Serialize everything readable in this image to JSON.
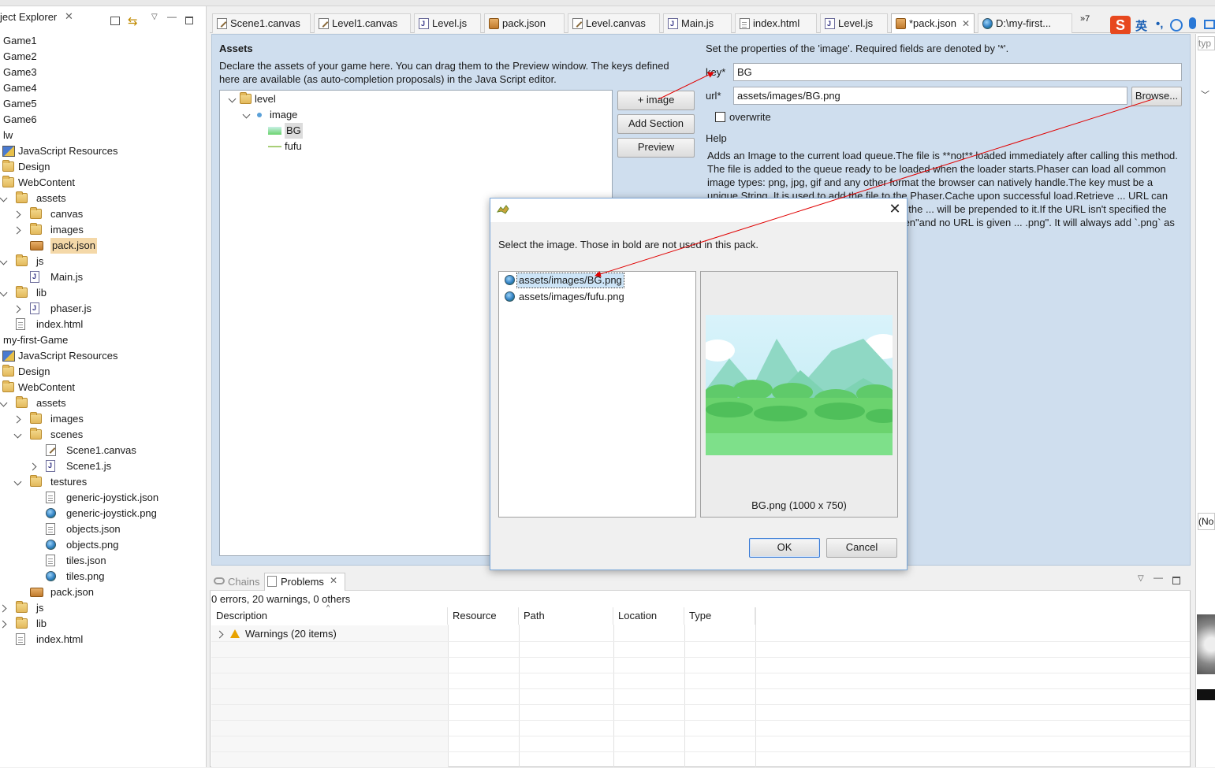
{
  "explorer": {
    "title": "ject Explorer",
    "rows": [
      {
        "label": "Game1",
        "icon": "project-icon",
        "depth": 0,
        "expander": "none"
      },
      {
        "label": "Game2",
        "icon": "project-icon",
        "depth": 0,
        "expander": "none"
      },
      {
        "label": "Game3",
        "icon": "project-icon",
        "depth": 0,
        "expander": "none"
      },
      {
        "label": "Game4",
        "icon": "project-icon",
        "depth": 0,
        "expander": "none"
      },
      {
        "label": "Game5",
        "icon": "project-icon",
        "depth": 0,
        "expander": "none"
      },
      {
        "label": "Game6",
        "icon": "project-icon",
        "depth": 0,
        "expander": "none"
      },
      {
        "label": "lw",
        "icon": "project-icon",
        "depth": 0,
        "expander": "none"
      },
      {
        "label": "JavaScript Resources",
        "icon": "js-resources-icon",
        "depth": 0,
        "expander": "none"
      },
      {
        "label": "Design",
        "icon": "folder-icon",
        "depth": 0,
        "expander": "none"
      },
      {
        "label": "WebContent",
        "icon": "folder-icon",
        "depth": 0,
        "expander": "none"
      },
      {
        "label": "assets",
        "icon": "folder-icon",
        "depth": 1,
        "expander": "open"
      },
      {
        "label": "canvas",
        "icon": "folder-icon",
        "depth": 2,
        "expander": "closed"
      },
      {
        "label": "images",
        "icon": "folder-icon",
        "depth": 2,
        "expander": "closed"
      },
      {
        "label": "pack.json",
        "icon": "pack-icon",
        "depth": 2,
        "expander": "none",
        "selected": true
      },
      {
        "label": "js",
        "icon": "folder-icon",
        "depth": 1,
        "expander": "open"
      },
      {
        "label": "Main.js",
        "icon": "js-file-icon",
        "depth": 2,
        "expander": "none"
      },
      {
        "label": "lib",
        "icon": "folder-icon",
        "depth": 1,
        "expander": "open"
      },
      {
        "label": "phaser.js",
        "icon": "js-file-icon",
        "depth": 2,
        "expander": "closed"
      },
      {
        "label": "index.html",
        "icon": "file-icon",
        "depth": 1,
        "expander": "none"
      },
      {
        "label": "my-first-Game",
        "icon": "project-icon",
        "depth": 0,
        "expander": "none"
      },
      {
        "label": "JavaScript Resources",
        "icon": "js-resources-icon",
        "depth": 0,
        "expander": "none"
      },
      {
        "label": "Design",
        "icon": "folder-icon",
        "depth": 0,
        "expander": "none"
      },
      {
        "label": "WebContent",
        "icon": "folder-icon",
        "depth": 0,
        "expander": "none"
      },
      {
        "label": "assets",
        "icon": "folder-icon",
        "depth": 1,
        "expander": "open"
      },
      {
        "label": "images",
        "icon": "folder-icon",
        "depth": 2,
        "expander": "closed"
      },
      {
        "label": "scenes",
        "icon": "folder-icon",
        "depth": 2,
        "expander": "open"
      },
      {
        "label": "Scene1.canvas",
        "icon": "canvas-file-icon",
        "depth": 3,
        "expander": "none"
      },
      {
        "label": "Scene1.js",
        "icon": "js-file-icon",
        "depth": 3,
        "expander": "closed"
      },
      {
        "label": "testures",
        "icon": "folder-icon",
        "depth": 2,
        "expander": "open"
      },
      {
        "label": "generic-joystick.json",
        "icon": "file-icon",
        "depth": 3,
        "expander": "none"
      },
      {
        "label": "generic-joystick.png",
        "icon": "image-file-icon",
        "depth": 3,
        "expander": "none"
      },
      {
        "label": "objects.json",
        "icon": "file-icon",
        "depth": 3,
        "expander": "none"
      },
      {
        "label": "objects.png",
        "icon": "image-file-icon",
        "depth": 3,
        "expander": "none"
      },
      {
        "label": "tiles.json",
        "icon": "file-icon",
        "depth": 3,
        "expander": "none"
      },
      {
        "label": "tiles.png",
        "icon": "image-file-icon",
        "depth": 3,
        "expander": "none"
      },
      {
        "label": "pack.json",
        "icon": "pack-icon",
        "depth": 2,
        "expander": "none"
      },
      {
        "label": "js",
        "icon": "folder-icon",
        "depth": 1,
        "expander": "closed"
      },
      {
        "label": "lib",
        "icon": "folder-icon",
        "depth": 1,
        "expander": "closed"
      },
      {
        "label": "index.html",
        "icon": "file-icon",
        "depth": 1,
        "expander": "none"
      }
    ]
  },
  "tabs": [
    {
      "label": "Scene1.canvas",
      "icon": "canvas-file-icon"
    },
    {
      "label": "Level1.canvas",
      "icon": "canvas-file-icon"
    },
    {
      "label": "Level.js",
      "icon": "js-file-icon"
    },
    {
      "label": "pack.json",
      "icon": "pack-icon"
    },
    {
      "label": "Level.canvas",
      "icon": "canvas-file-icon"
    },
    {
      "label": "Main.js",
      "icon": "js-file-icon"
    },
    {
      "label": "index.html",
      "icon": "file-icon"
    },
    {
      "label": "Level.js",
      "icon": "js-file-icon"
    },
    {
      "label": "*pack.json",
      "icon": "pack-icon",
      "active": true,
      "closable": true
    },
    {
      "label": "D:\\my-first...",
      "icon": "globe-icon"
    }
  ],
  "tabs_overflow": "»7",
  "ime": {
    "logo": "S",
    "lang": "英"
  },
  "assets": {
    "title": "Assets",
    "description": "Declare the assets of your game here. You can drag them to the Preview window. The keys defined here are available (as auto-completion proposals) in the Java Script editor.",
    "tree": [
      {
        "label": "level",
        "icon": "section-icon",
        "depth": 0,
        "expander": "open"
      },
      {
        "label": "image",
        "icon": "type-dot-icon",
        "depth": 1,
        "expander": "open"
      },
      {
        "label": "BG",
        "icon": "image-thumb-icon",
        "depth": 2,
        "expander": "none",
        "selected": true
      },
      {
        "label": "fufu",
        "icon": "image-thumb-icon",
        "depth": 2,
        "expander": "none"
      }
    ],
    "add_image_label": "+ image",
    "add_section_label": "Add Section",
    "preview_label": "Preview"
  },
  "properties": {
    "title": "Set the properties of the 'image'. Required fields are denoted by '*'.",
    "key_label": "key*",
    "key_value": "BG",
    "url_label": "url*",
    "url_value": "assets/images/BG.png",
    "browse_label": "Browse...",
    "overwrite_label": "overwrite",
    "overwrite_checked": false,
    "help_title": "Help",
    "help_text": "Adds an Image to the current load queue.The file is **not** loaded immediately after calling this method. The file is added to the queue ready to be loaded when the loader starts.Phaser can load all common image types: png, jpg, gif and any other format the browser can natively handle.The key must be a unique String. It is used to add the file to the Phaser.Cache upon successful load.Retrieve ... URL can be relative or absolute. If the URL is relative the ... will be prepended to it.If the URL isn't specified the Loader ... that. For example if the key is \"alien\"and no URL is given ... .png\". It will always add `.png` as the extension.If you do"
  },
  "right_strip": {
    "filter_placeholder": "typ",
    "combo_value": "(No"
  },
  "problems": {
    "tab_chains": "Chains",
    "tab_problems": "Problems",
    "summary": "0 errors, 20 warnings, 0 others",
    "columns": [
      "Description",
      "Resource",
      "Path",
      "Location",
      "Type"
    ],
    "rows": [
      {
        "description": "Warnings (20 items)",
        "severity": "warning"
      }
    ]
  },
  "dialog": {
    "message": "Select the  image. Those in bold are not used in this pack.",
    "items": [
      {
        "label": "assets/images/BG.png",
        "selected": true
      },
      {
        "label": "assets/images/fufu.png",
        "selected": false
      }
    ],
    "preview_caption": "BG.png (1000 x 750)",
    "ok_label": "OK",
    "cancel_label": "Cancel"
  },
  "colors": {
    "accent": "#3a7bd5",
    "editor_bg": "#cfdeee",
    "annotation_arrow": "#e00000",
    "ime_brand": "#e7481e"
  }
}
